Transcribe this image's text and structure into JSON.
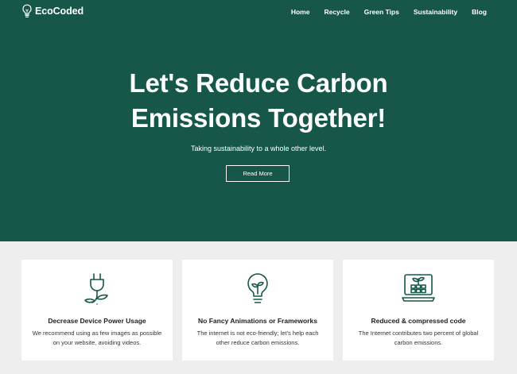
{
  "header": {
    "brand_name": "EcoCoded",
    "brand_icon": "lightbulb-icon",
    "nav": [
      "Home",
      "Recycle",
      "Green Tips",
      "Sustainability",
      "Blog"
    ]
  },
  "hero": {
    "title_line1": "Let's Reduce Carbon",
    "title_line2": "Emissions Together!",
    "subtitle": "Taking sustainability to a whole other level.",
    "button_label": "Read More"
  },
  "features": [
    {
      "icon": "power-plug-plant-icon",
      "title": "Decrease Device Power Usage",
      "text": "We recommend using as few images as possible on your website, avoiding videos."
    },
    {
      "icon": "lightbulb-icon",
      "title": "No Fancy Animations or Frameworks",
      "text": "The internet is not eco-friendly; let's help each other reduce carbon emissions."
    },
    {
      "icon": "laptop-plant-icon",
      "title": "Reduced & compressed code",
      "text": "The Internet contributes two percent of global carbon emissions."
    }
  ],
  "colors": {
    "hero_bg": "#17574a",
    "page_bg": "#eeeeee",
    "card_bg": "#ffffff",
    "icon_stroke": "#17574a"
  }
}
